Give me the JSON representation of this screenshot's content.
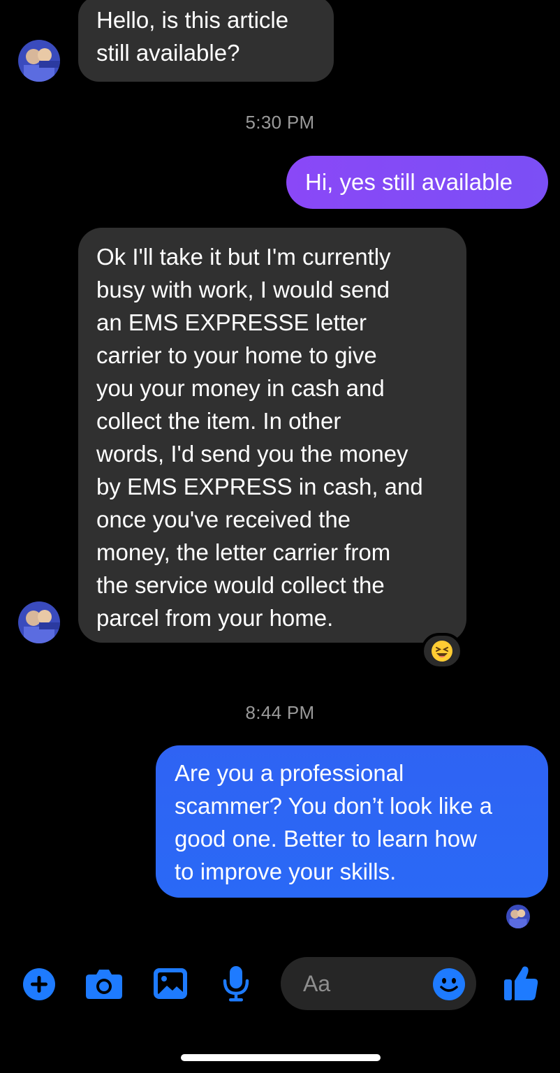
{
  "conversation": {
    "messages": [
      {
        "direction": "incoming",
        "text": "Hello, is this article\nstill available?"
      },
      {
        "direction": "outgoing",
        "text": "Hi, yes still available"
      },
      {
        "direction": "incoming",
        "text": "Ok I'll take it but I'm currently\nbusy with work, I would send\nan EMS EXPRESSE letter\ncarrier to your home to give\nyou your money in cash and\ncollect the item. In other\nwords, I'd send you the money\nby EMS EXPRESS in cash, and\nonce you've received the\nmoney, the letter carrier from\nthe service would collect the\nparcel from your home.",
        "reaction": "😆"
      },
      {
        "direction": "outgoing",
        "text": "Are you a professional\nscammer? You don’t look like a\ngood one. Better to learn how\nto improve your skills."
      }
    ],
    "timestamps": [
      "5:30 PM",
      "8:44 PM"
    ]
  },
  "composer": {
    "placeholder": "Aa"
  },
  "toolbar": {
    "icons": [
      "plus-icon",
      "camera-icon",
      "image-icon",
      "microphone-icon",
      "emoji-icon",
      "thumbs-up-icon"
    ]
  },
  "colors": {
    "background": "#000000",
    "incoming_bubble": "#303030",
    "outgoing_purple": "#8a48f7",
    "outgoing_blue": "#2f63f3",
    "accent": "#1e7bff",
    "timestamp": "#9a9a9a"
  }
}
